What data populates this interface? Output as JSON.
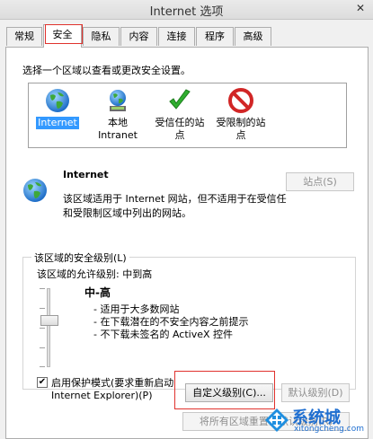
{
  "window": {
    "title": "Internet 选项"
  },
  "tabs": [
    "常规",
    "安全",
    "隐私",
    "内容",
    "连接",
    "程序",
    "高级"
  ],
  "prompt": "选择一个区域以查看或更改安全设置。",
  "zones": [
    {
      "label": "Internet",
      "icon": "globe-icon"
    },
    {
      "label": "本地 Intranet",
      "line1": "本地",
      "line2": "Intranet",
      "icon": "intranet-icon"
    },
    {
      "label": "受信任的站点",
      "line1": "受信任的站",
      "line2": "点",
      "icon": "check-icon"
    },
    {
      "label": "受限制的站点",
      "line1": "受限制的站",
      "line2": "点",
      "icon": "restricted-icon"
    }
  ],
  "selected_zone": {
    "title": "Internet",
    "description": "该区域适用于 Internet 网站，但不适用于在受信任和受限制区域中列出的网站。",
    "sites_button": "站点(S)"
  },
  "security_level": {
    "group_label": "该区域的安全级别(L)",
    "allowed_label": "该区域的允许级别: 中到高",
    "level_name": "中-高",
    "bullets": [
      "- 适用于大多数网站",
      "- 在下载潜在的不安全内容之前提示",
      "- 不下载未签名的 ActiveX 控件"
    ],
    "slider_level_fraction": 0.6
  },
  "protected_mode": {
    "checked": true,
    "mark": "✔",
    "label": "启用保护模式(要求重新启动 Internet Explorer)(P)"
  },
  "buttons": {
    "custom_level": "自定义级别(C)...",
    "default_level": "默认级别(D)",
    "reset_all": "将所有区域重置为默认级别(R)"
  },
  "watermark": {
    "name": "系统城",
    "url": "xitongcheng.com"
  },
  "colors": {
    "highlight_box": "#e0322d",
    "selection": "#3399ff",
    "watermark": "#1f6fd1"
  }
}
